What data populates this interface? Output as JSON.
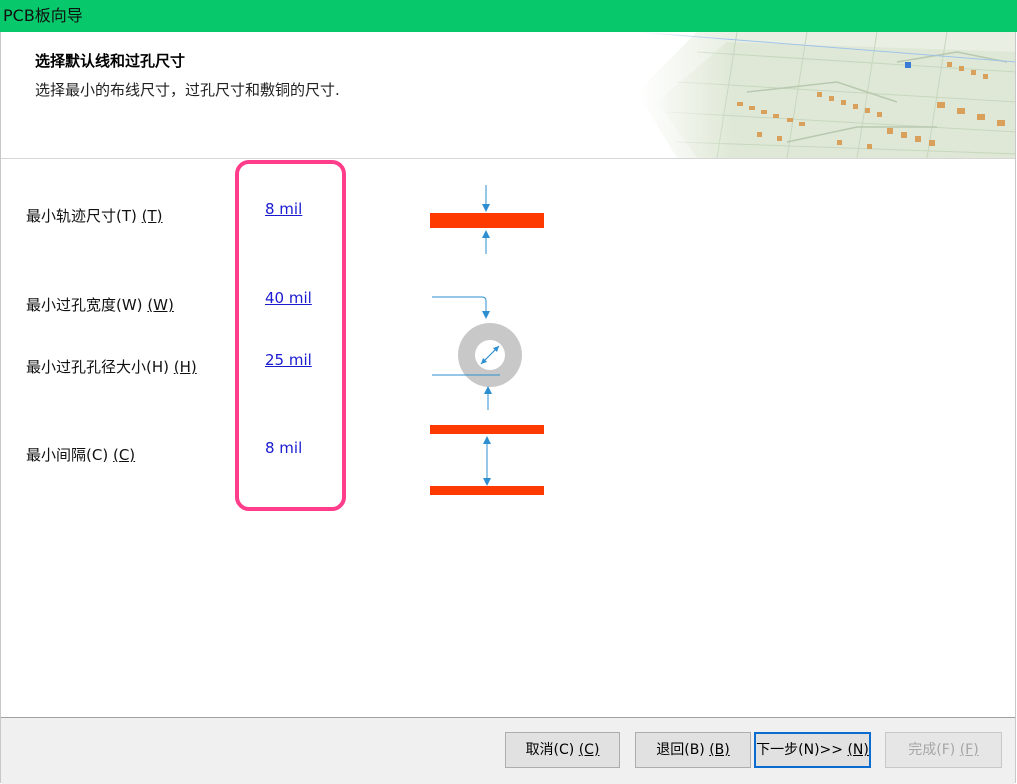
{
  "window": {
    "title": "PCB板向导"
  },
  "header": {
    "title": "选择默认线和过孔尺寸",
    "subtitle": "选择最小的布线尺寸，过孔尺寸和敷铜的尺寸."
  },
  "fields": {
    "track": {
      "label": "最小轨迹尺寸(T)",
      "mnemonic": "(T)",
      "value": "8 mil"
    },
    "via_width": {
      "label": "最小过孔宽度(W)",
      "mnemonic": "(W)",
      "value": "40 mil"
    },
    "via_hole": {
      "label": "最小过孔孔径大小(H)",
      "mnemonic": "(H)",
      "value": "25 mil"
    },
    "clearance": {
      "label": "最小间隔(C)",
      "mnemonic": "(C)",
      "value": "8 mil"
    }
  },
  "buttons": {
    "cancel": {
      "label": "取消(C)",
      "mnemonic": "(C)"
    },
    "back": {
      "label": "退回(B)",
      "mnemonic": "(B)"
    },
    "next": {
      "label": "下一步(N)>>",
      "mnemonic": "(N)"
    },
    "finish": {
      "label": "完成(F)",
      "mnemonic": "(F)"
    }
  },
  "colors": {
    "titlebar": "#07c86a",
    "highlight": "#ff3d8a",
    "track": "#ff3a00",
    "dimension_arrow": "#2e8fd0",
    "via_ring": "#c8c8c8",
    "value_link": "#1a1ad0"
  }
}
